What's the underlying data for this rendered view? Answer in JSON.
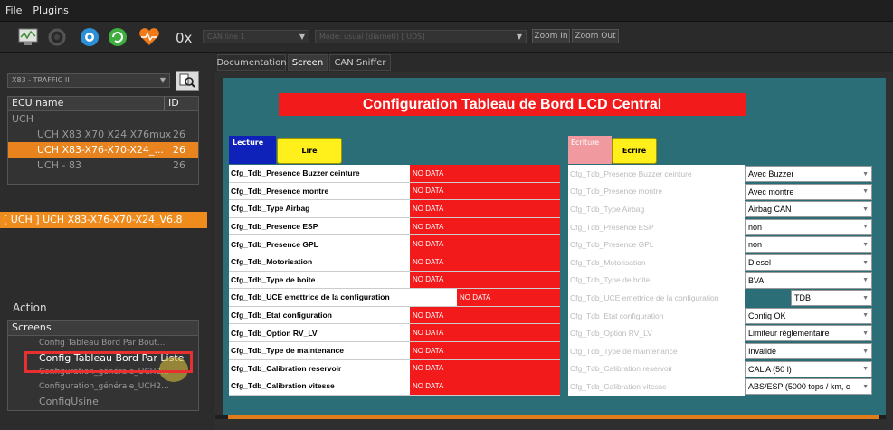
{
  "menu": {
    "file": "File",
    "plugins": "Plugins"
  },
  "toolbar": {
    "counter": "0x",
    "can_select": "CAN line 1",
    "proto_select": "Mode: usual (diarneti) [ UDS]",
    "zoom_in": "Zoom In",
    "zoom_out": "Zoom Out"
  },
  "left": {
    "ecu_select": "X83 - TRAFFIC II",
    "tree": {
      "col_name": "ECU name",
      "col_id": "ID",
      "rows": [
        {
          "name": "UCH",
          "id": ""
        },
        {
          "name": "UCH X83 X70 X24 X76mux",
          "id": "26"
        },
        {
          "name": "UCH X83-X76-X70-X24_...",
          "id": "26"
        },
        {
          "name": "UCH - 83",
          "id": "26"
        }
      ]
    },
    "selected_ecu": "[ UCH ] UCH X83-X76-X70-X24_V6.8",
    "action_label": "Action",
    "screens_label": "Screens",
    "screens": [
      "Config Tableau Bord Par Bout...",
      "Config Tableau Bord Par Liste",
      "Configuration_générale_UCH2...",
      "Configuration_générale_UCH2...",
      "ConfigUsine"
    ]
  },
  "tabs": [
    "Documentation",
    "Screen",
    "CAN Sniffer"
  ],
  "screen": {
    "title": "Configuration Tableau de Bord LCD Central",
    "lecture_label": "Lecture",
    "lire_button": "Lire",
    "ecriture_label": "Ecriture",
    "ecrire_button": "Ecrire",
    "read_rows": [
      {
        "label": "Cfg_Tdb_Presence Buzzer ceinture",
        "value": "NO DATA"
      },
      {
        "label": "Cfg_Tdb_Presence montre",
        "value": "NO DATA"
      },
      {
        "label": "Cfg_Tdb_Type Airbag",
        "value": "NO DATA"
      },
      {
        "label": "Cfg_Tdb_Presence ESP",
        "value": "NO DATA"
      },
      {
        "label": "Cfg_Tdb_Presence GPL",
        "value": "NO DATA"
      },
      {
        "label": "Cfg_Tdb_Motorisation",
        "value": "NO DATA"
      },
      {
        "label": "Cfg_Tdb_Type de boite",
        "value": "NO DATA"
      },
      {
        "label": "Cfg_Tdb_UCE emettrice de la configuration",
        "value": "NO DATA"
      },
      {
        "label": "Cfg_Tdb_Etat configuration",
        "value": "NO DATA"
      },
      {
        "label": "Cfg_Tdb_Option RV_LV",
        "value": "NO DATA"
      },
      {
        "label": "Cfg_Tdb_Type de maintenance",
        "value": "NO DATA"
      },
      {
        "label": "Cfg_Tdb_Calibration reservoir",
        "value": "NO DATA"
      },
      {
        "label": "Cfg_Tdb_Calibration vitesse",
        "value": "NO DATA"
      }
    ],
    "write_rows": [
      {
        "label": "Cfg_Tdb_Presence Buzzer ceinture",
        "value": "Avec Buzzer"
      },
      {
        "label": "Cfg_Tdb_Presence montre",
        "value": "Avec montre"
      },
      {
        "label": "Cfg_Tdb_Type Airbag",
        "value": "Airbag CAN"
      },
      {
        "label": "Cfg_Tdb_Presence ESP",
        "value": "non"
      },
      {
        "label": "Cfg_Tdb_Presence GPL",
        "value": "non"
      },
      {
        "label": "Cfg_Tdb_Motorisation",
        "value": "Diesel"
      },
      {
        "label": "Cfg_Tdb_Type de boite",
        "value": "BVA"
      },
      {
        "label": "Cfg_Tdb_UCE emettrice de la configuration",
        "value": "TDB"
      },
      {
        "label": "Cfg_Tdb_Etat configuration",
        "value": "Config OK"
      },
      {
        "label": "Cfg_Tdb_Option RV_LV",
        "value": "Limiteur règlementaire"
      },
      {
        "label": "Cfg_Tdb_Type de maintenance",
        "value": "Invalide"
      },
      {
        "label": "Cfg_Tdb_Calibration reservoir",
        "value": "CAL A (50 l)"
      },
      {
        "label": "Cfg_Tdb_Calibration vitesse",
        "value": "ABS/ESP (5000 tops / km, c"
      }
    ]
  }
}
